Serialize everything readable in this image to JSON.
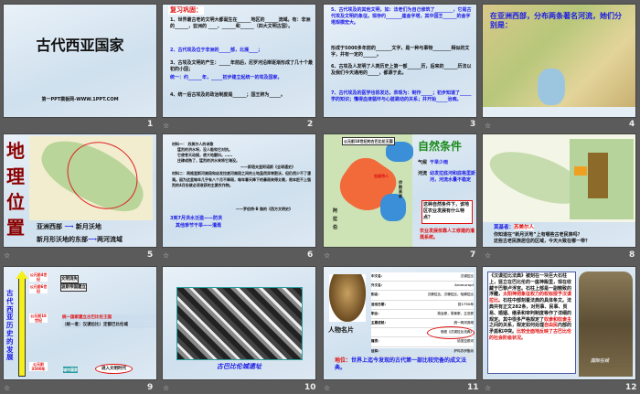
{
  "slides": [
    {
      "num": "1",
      "title": "古代西亚国家",
      "footer": "第一PPT模板网-WWW.1PPT.COM"
    },
    {
      "num": "2",
      "heading": "复习巩固：",
      "lines": [
        "1、世界最古老的文明大都诞生在______地区的______流域。有：非洲的______，亚洲的 ____、______和______（四大文明古国）。",
        "2、古代埃及位于非洲的_____部，北濒____；",
        "3、古埃及文明的产生：_____年前后，尼罗河沿岸逐渐形成了几十个最初的小国；",
        "统一：约______年，_____初步建立起统一的埃及国家。",
        "4、统一后古埃及的政治制度是______；国王称为_____。"
      ]
    },
    {
      "num": "3",
      "lines": [
        "5、古代埃及的其他文明，如：法老们为自己修筑了________，它是古代埃及文明的象征。现存约_______座金字塔，其中国王______的金字塔规模宏大。",
        "形成于5000多年前的_______文字，是一种与事物________相似的文字，并有一定的______。",
        "6、古埃及人发明了人类历史上第一部______历，后来的______历法以及我们今天通用的_____，都源于此。",
        "7、古代埃及的医学也很发达，表现为：制作_____；初步知道了_____学的知识；懂得血液循环与心脏跳动的关系；并开始_____治病。"
      ]
    },
    {
      "num": "4",
      "text": "在亚洲西部，分布两条著名河流，她们分别是："
    },
    {
      "num": "5",
      "title": "地理位置",
      "line1a": "亚洲西部",
      "line1b": "新月沃地",
      "line2a": "新月形沃地的东部",
      "line2b": "两河流域"
    },
    {
      "num": "6",
      "lines": [
        "材料一：  苏美尔人的诗歌",
        "猛烈的洪水呀，没人能和它对抗。",
        "它使苍天动摇，使大地颤抖。……",
        "庄稼成熟了，猛烈的洪水来将它淹没。",
        "——斯塔夫里阿诺斯《全球通史》",
        "材料二：两格里斯河南段和幼发拉底河南段之间的土地虽然异常肥沃，但仍然少不了灌溉。因为这里每年几乎有八个月不降雨，每年春天降下的暴雨来得太晚，根本赶不上强烈的4月份就必须收获的主要农作物。",
        "——罗伯特·B 路的《西方文明史》"
      ],
      "note1": "3到7月洪水泛滥——防洪",
      "note2": "其他季节干旱——灌溉"
    },
    {
      "num": "7",
      "map_title": "公元前18世纪的古巴比伦王国",
      "title": "自然条件",
      "climate_label": "气候",
      "climate": "干旱少雨",
      "river_label": "河流",
      "river": "幼发拉底河和底格里斯河，河流水量不稳定",
      "question": "这种自然条件下，该地区农业发展有什么特点？",
      "answer": "农业发展依靠人工修建的灌溉系统。",
      "labels": [
        "伊朗高原",
        "阿拉伯",
        "加喜特人"
      ]
    },
    {
      "num": "8",
      "speaker": "莫基者：",
      "speaker_name": "苏美尔人",
      "q1": "你知道在“新月沃地”上有哪些古老民族吗？",
      "q2": "这些古老民族居住的区域，今天大致在哪一带？"
    },
    {
      "num": "9",
      "vertical_title": "古代西亚历史的发展",
      "events": [
        {
          "time": "公元前4世纪",
          "label": "文明消失"
        },
        {
          "time": "公元前6世纪",
          "label": "波斯帝国建立"
        },
        {
          "time": "公元前18世纪",
          "label": "统一国家建立古巴比伦王国",
          "sub": "（统一者：汉谟拉比）定都巴比伦城"
        },
        {
          "time": "公元前3500年",
          "label": "城市国家",
          "note": "进入文明时代"
        }
      ]
    },
    {
      "num": "10",
      "caption": "古巴比伦城遗址"
    },
    {
      "num": "11",
      "fields": [
        [
          "中文名：",
          "汉谟拉比"
        ],
        [
          "外文名：",
          "Ammurapi"
        ],
        [
          "别名：",
          "汉摩拉比，汉穆拉比，哈摩拉比"
        ],
        [
          "逝世日期：",
          "前1750年"
        ],
        [
          "职业：",
          "政治家，军事家，立法家"
        ],
        [
          "主要成就：",
          "统一两河流域"
        ],
        [
          "",
          "制定《汉谟拉比法典》"
        ],
        [
          "籍贯：",
          "幼发拉底河"
        ],
        [
          "信仰：",
          "萨玛苏伊鲁纳"
        ]
      ],
      "card_title": "人物名片",
      "status_label": "地位：",
      "status": "世界上迄今发现的古代第一部比较完备的成文法典。"
    },
    {
      "num": "12",
      "text": "《汉谟拉比法典》被刻在一块巨大石柱上，竖立在巴比伦的一座神殿里，现在收藏于巴黎卢浮宫。石柱上部是一副精致的浮雕，",
      "red1": "太阳神把象征权力的权标授予汉谟拉比。",
      "text2": "石柱中部刻着法典的具体条文。法典共有正文282条，对刑事、民事、贸易、婚姻、继承和审判制度等作了详细的规定。其中很多严格规定了",
      "red2": "奴隶和奴隶主",
      "text3": "之间的关系，规定如何处理",
      "red3": "自由民",
      "text4": "内部的矛盾和冲突。",
      "red4": "比较全面地反映了古巴比伦的社会阶级状况。",
      "watermark": "国际在线"
    }
  ],
  "anim_icon": "animation-star-icon"
}
